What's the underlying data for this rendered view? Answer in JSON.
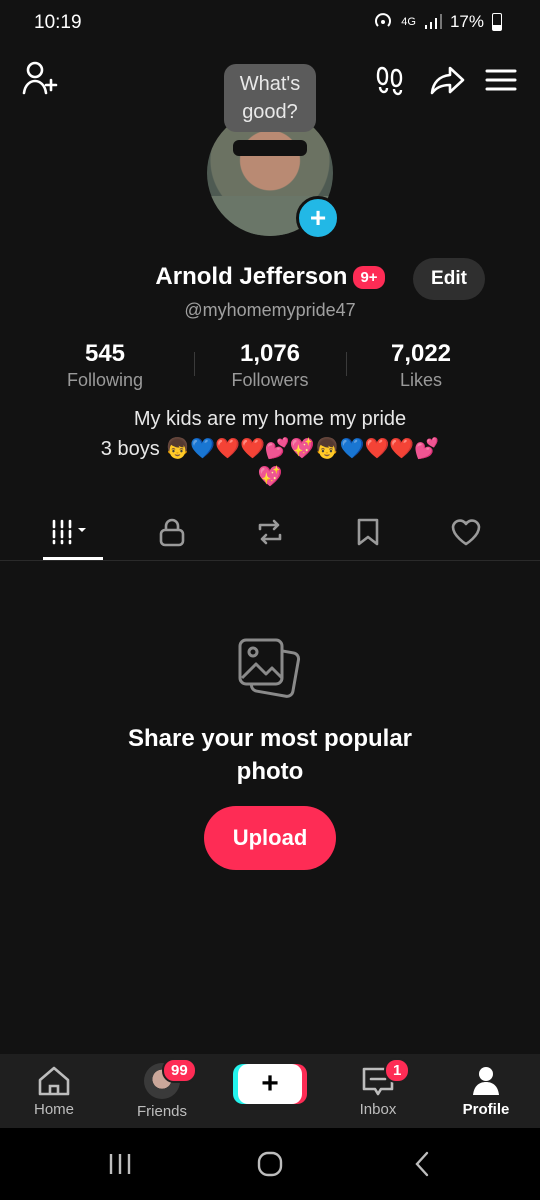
{
  "status": {
    "time": "10:19",
    "network": "4G",
    "battery": "17%"
  },
  "tooltip": {
    "text": "What's good?"
  },
  "profile": {
    "name": "Arnold Jefferson",
    "notif_badge": "9+",
    "edit_label": "Edit",
    "handle": "@myhomemypride47"
  },
  "stats": [
    {
      "value": "545",
      "label": "Following"
    },
    {
      "value": "1,076",
      "label": "Followers"
    },
    {
      "value": "7,022",
      "label": "Likes"
    }
  ],
  "bio": {
    "line1": "My kids are my home my pride",
    "line2": "3 boys 👦💙❤️❤️💕💖👦💙❤️❤️💕",
    "line3": "💖"
  },
  "tabs": [
    "videos",
    "private",
    "reposts",
    "favorites",
    "liked"
  ],
  "empty_state": {
    "title": "Share your most popular photo",
    "button": "Upload"
  },
  "bottom_nav": {
    "home": "Home",
    "friends": "Friends",
    "friends_badge": "99",
    "inbox": "Inbox",
    "inbox_badge": "1",
    "profile": "Profile"
  },
  "colors": {
    "accent": "#fe2c55",
    "cyan": "#25f4ee",
    "bg": "#121212"
  }
}
